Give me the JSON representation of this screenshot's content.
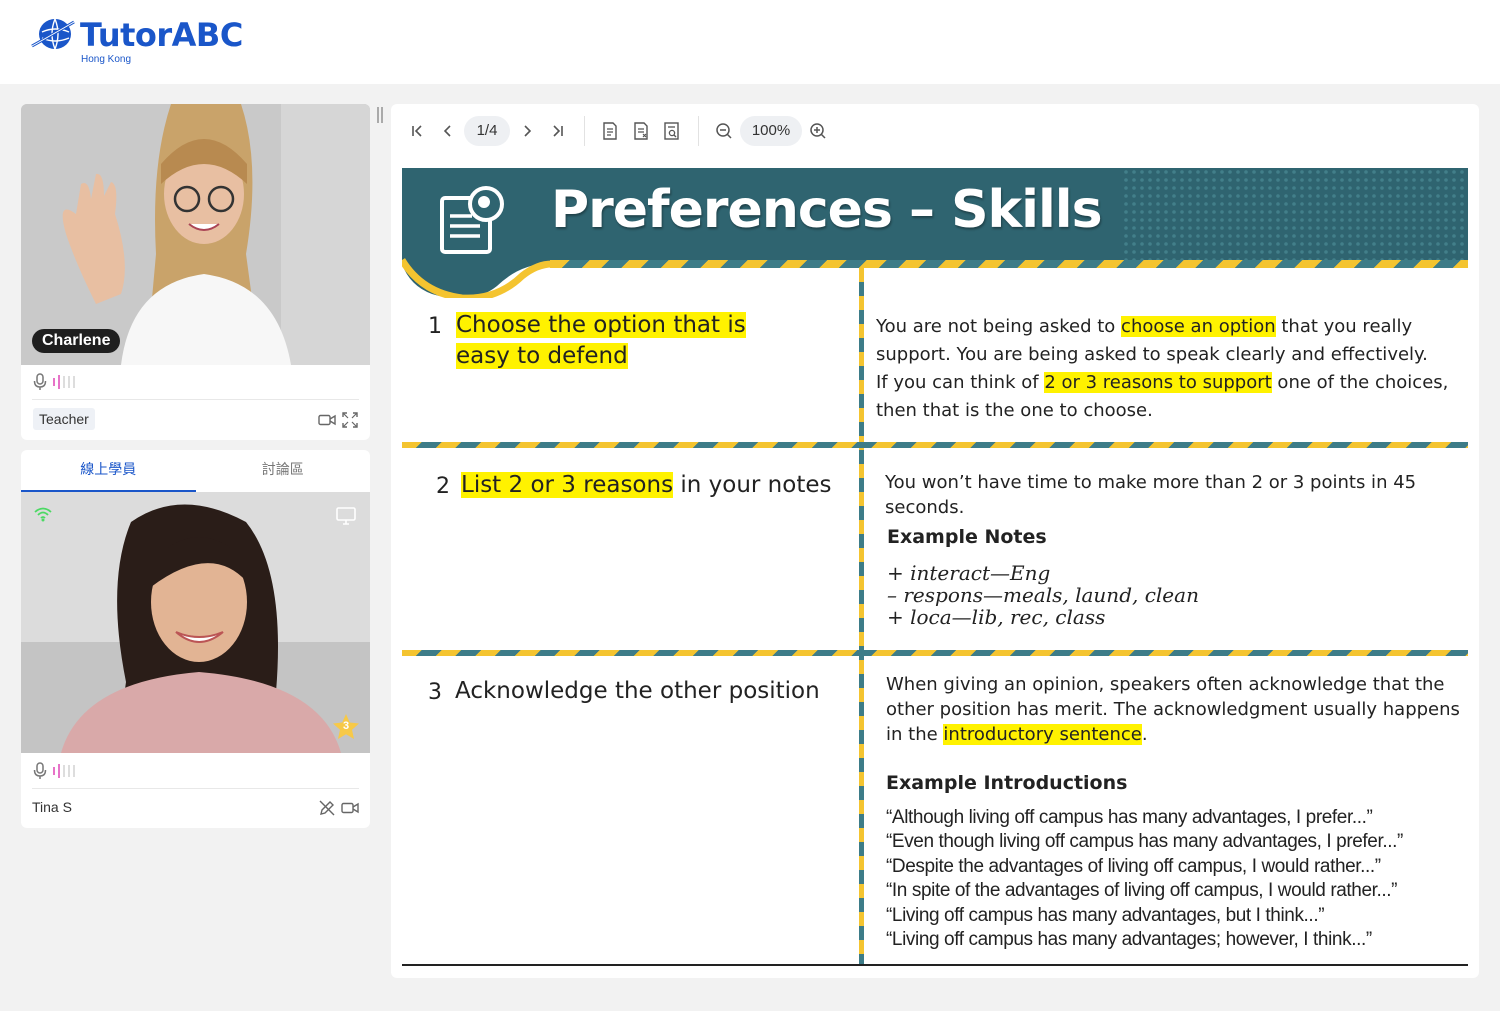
{
  "brand": {
    "name": "TutorABC",
    "region": "Hong Kong",
    "color": "#1a56c9"
  },
  "teacher": {
    "name": "Charlene",
    "role": "Teacher"
  },
  "student_panel": {
    "tabs": [
      {
        "label": "線上學員",
        "active": true
      },
      {
        "label": "討論區",
        "active": false
      }
    ],
    "student_name": "Tina S",
    "star_count": "3"
  },
  "viewer": {
    "page": "1/4",
    "zoom": "100%"
  },
  "slide": {
    "title": "Preferences – Skills",
    "rows": [
      {
        "number": "1",
        "left_highlight": "Choose the option that is easy to defend",
        "right": {
          "line1_pre": "You are not being asked to ",
          "line1_hl": "choose an option",
          "line1_post": " that you really",
          "line2": "support. You are being asked to speak clearly and effectively.",
          "line3_pre": "If you can think of ",
          "line3_hl": "2 or 3 reasons to support",
          "line3_post": " one of the choices,",
          "line4": "then that is the one to choose."
        }
      },
      {
        "number": "2",
        "left_highlight": "List 2 or 3 reasons",
        "left_rest": " in your notes",
        "right": {
          "text": "You won’t have time to make more than 2 or 3 points in 45 seconds.",
          "heading": "Example Notes",
          "notes": [
            "+ interact—Eng",
            "– respons—meals, laund, clean",
            "+ loca—lib, rec, class"
          ]
        }
      },
      {
        "number": "3",
        "left_text": "Acknowledge the other position",
        "right": {
          "text_pre": "When giving an opinion, speakers often acknowledge that the other position has merit. The acknowledgment usually happens in the ",
          "text_hl": "introductory sentence",
          "text_post": ".",
          "heading": "Example Introductions",
          "examples": [
            "“Although living off campus has many advantages, I prefer...”",
            "“Even though living off campus has many advantages, I prefer...”",
            "“Despite the advantages of living off campus, I would rather...”",
            "“In spite of the advantages of living off campus, I would rather...”",
            "“Living off campus has many advantages, but I think...”",
            "“Living off campus has many advantages; however, I think...”"
          ]
        }
      }
    ]
  },
  "colors": {
    "highlight": "#fff200",
    "banner_teal": "#2f6470",
    "stripe_yellow": "#f4c430",
    "stripe_teal": "#3d7c88",
    "mic_level": "#e773c8"
  }
}
